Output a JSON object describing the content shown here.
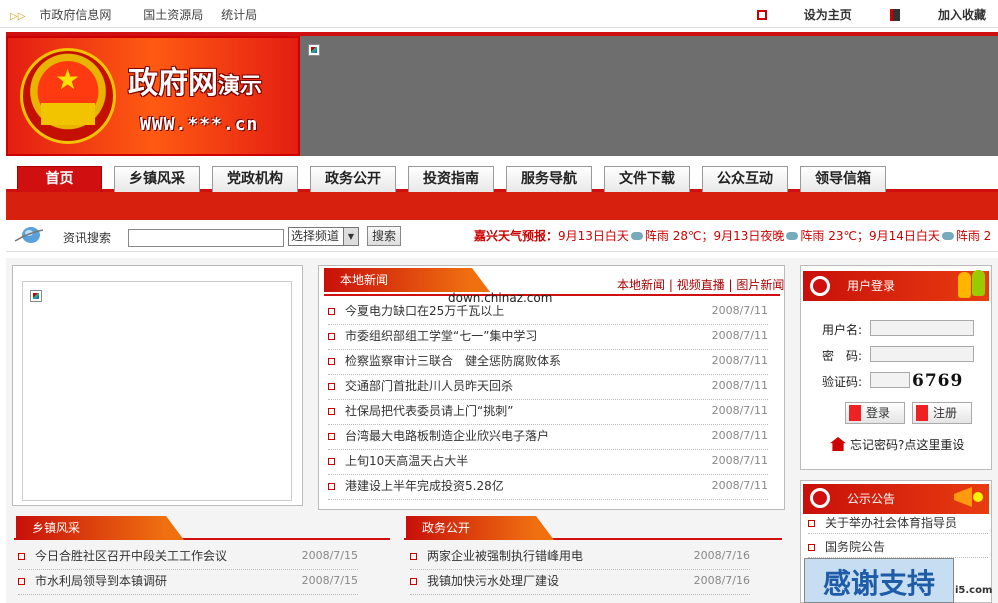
{
  "topbar": {
    "links": [
      "市政府信息网",
      "国土资源局",
      "统计局"
    ],
    "set_home": "设为主页",
    "add_fav": "加入收藏"
  },
  "header": {
    "title_main": "政府网",
    "title_sub": "演示",
    "url": "WWW.***.cn"
  },
  "nav": {
    "tabs": [
      "首页",
      "乡镇风采",
      "党政机构",
      "政务公开",
      "投资指南",
      "服务导航",
      "文件下载",
      "公众互动",
      "领导信箱"
    ]
  },
  "search": {
    "label": "资讯搜索",
    "channel_selected": "选择频道",
    "button": "搜索"
  },
  "weather": {
    "label": "嘉兴天气预报：",
    "text1": "9月13日白天",
    "cond1": "阵雨 28℃；9月13日夜晚",
    "cond2": "阵雨 23℃；9月14日白天",
    "cond3": "阵雨 2"
  },
  "news": {
    "title": "本地新闻",
    "links": [
      "本地新闻",
      "视频直播",
      "图片新闻"
    ],
    "items": [
      {
        "title": "今夏电力缺口在25万千瓦以上",
        "date": "2008/7/11"
      },
      {
        "title": "市委组织部组工学堂“七一”集中学习",
        "date": "2008/7/11"
      },
      {
        "title": "检察监察审计三联合　健全惩防腐败体系",
        "date": "2008/7/11"
      },
      {
        "title": "交通部门首批赴川人员昨天回杀",
        "date": "2008/7/11"
      },
      {
        "title": "社保局把代表委员请上门“挑刺”",
        "date": "2008/7/11"
      },
      {
        "title": "台湾最大电路板制造企业欣兴电子落户",
        "date": "2008/7/11"
      },
      {
        "title": "上旬10天高温天占大半",
        "date": "2008/7/11"
      },
      {
        "title": "港建设上半年完成投资5.28亿",
        "date": "2008/7/11"
      }
    ]
  },
  "watermark": "down.chinaz.com",
  "login": {
    "title": "用户登录",
    "username_label": "用户名:",
    "password_label": "密　码:",
    "captcha_label": "验证码:",
    "captcha": "6769",
    "login_button": "登录",
    "register_button": "注册",
    "forgot": "忘记密码?点这里重设"
  },
  "announce": {
    "title": "公示公告",
    "items": [
      "关于举办社会体育指导员",
      "国务院公告"
    ],
    "banner": "感谢支持",
    "logo": "i5.com"
  },
  "township": {
    "title": "乡镇风采",
    "items": [
      {
        "title": "今日合胜社区召开中段关工工作会议",
        "date": "2008/7/15"
      },
      {
        "title": "市水利局领导到本镇调研",
        "date": "2008/7/15"
      }
    ]
  },
  "affairs": {
    "title": "政务公开",
    "items": [
      {
        "title": "两家企业被强制执行错峰用电",
        "date": "2008/7/16"
      },
      {
        "title": "我镇加快污水处理厂建设",
        "date": "2008/7/16"
      }
    ]
  }
}
